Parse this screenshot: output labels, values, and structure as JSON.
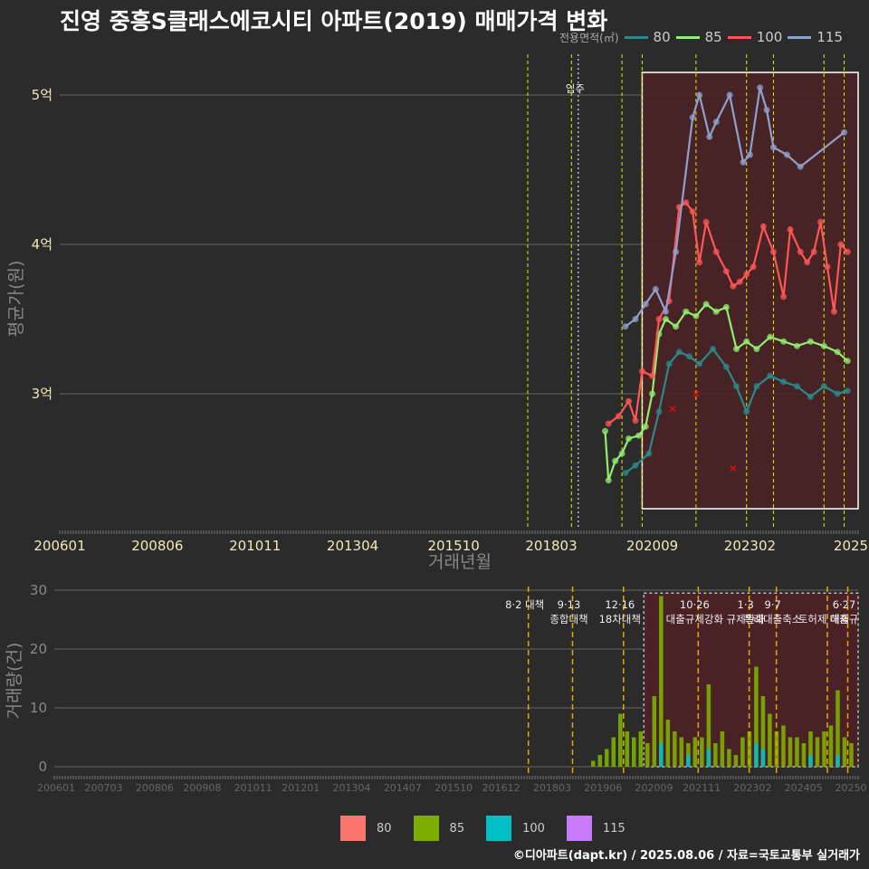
{
  "title": "진영 중흥S클래스에코시티 아파트(2019) 매매가격 변화",
  "legend_title": "전용면적(㎡)",
  "credit": "©디아파트(dapt.kr) / 2025.08.06 / 자료=국토교통부 실거래가",
  "colors": {
    "s80": "#f8766d",
    "s85": "#7cae00",
    "s100": "#00bfc4",
    "s115": "#c77cff",
    "line80": "#2a8a8a",
    "line85": "#90ee70",
    "line100": "#ff5555",
    "line115": "#8fa0cc",
    "vline": "#e6e600",
    "vline_bottom": "#e6a800",
    "highlight": "#4a2226",
    "box": "#ffffff"
  },
  "chart_data": [
    {
      "type": "line",
      "title": "진영 중흥S클래스에코시티 아파트(2019) 매매가격 변화",
      "xlabel": "거래년월",
      "ylabel": "평균가(원)",
      "x_ticks": [
        "200601",
        "200806",
        "201011",
        "201304",
        "201510",
        "201803",
        "202009",
        "202302",
        "2025"
      ],
      "y_ticks": [
        {
          "v": 3.0,
          "label": "3억"
        },
        {
          "v": 4.0,
          "label": "4억"
        },
        {
          "v": 5.0,
          "label": "5억"
        }
      ],
      "xlim": [
        "200512",
        "202508"
      ],
      "ylim": [
        2.1,
        5.3
      ],
      "legend": [
        "80",
        "85",
        "100",
        "115"
      ],
      "annotations": [
        {
          "x": "2018-11",
          "text": "입주"
        }
      ],
      "vlines": [
        "2017-08",
        "2018-09",
        "2019-12",
        "2020-06",
        "2021-10",
        "2023-01",
        "2023-09",
        "2024-12",
        "2025-06"
      ],
      "highlight_range": [
        "2020-06",
        "2025-08"
      ],
      "series": [
        {
          "name": "80",
          "points": [
            [
              "2020-01",
              2.47
            ],
            [
              "2020-04",
              2.52
            ],
            [
              "2020-08",
              2.6
            ],
            [
              "2020-11",
              2.88
            ],
            [
              "2021-02",
              3.2
            ],
            [
              "2021-05",
              3.28
            ],
            [
              "2021-08",
              3.25
            ],
            [
              "2021-11",
              3.2
            ],
            [
              "2022-03",
              3.3
            ],
            [
              "2022-07",
              3.18
            ],
            [
              "2022-10",
              3.05
            ],
            [
              "2023-01",
              2.88
            ],
            [
              "2023-04",
              3.05
            ],
            [
              "2023-08",
              3.12
            ],
            [
              "2023-12",
              3.08
            ],
            [
              "2024-04",
              3.05
            ],
            [
              "2024-08",
              2.98
            ],
            [
              "2024-12",
              3.05
            ],
            [
              "2025-04",
              3.0
            ],
            [
              "2025-07",
              3.02
            ]
          ]
        },
        {
          "name": "85",
          "points": [
            [
              "2019-07",
              2.75
            ],
            [
              "2019-08",
              2.42
            ],
            [
              "2019-10",
              2.55
            ],
            [
              "2019-12",
              2.6
            ],
            [
              "2020-02",
              2.7
            ],
            [
              "2020-05",
              2.72
            ],
            [
              "2020-07",
              2.78
            ],
            [
              "2020-09",
              3.0
            ],
            [
              "2020-11",
              3.4
            ],
            [
              "2021-01",
              3.5
            ],
            [
              "2021-04",
              3.45
            ],
            [
              "2021-07",
              3.55
            ],
            [
              "2021-10",
              3.52
            ],
            [
              "2022-01",
              3.6
            ],
            [
              "2022-04",
              3.55
            ],
            [
              "2022-07",
              3.58
            ],
            [
              "2022-10",
              3.3
            ],
            [
              "2023-01",
              3.35
            ],
            [
              "2023-04",
              3.3
            ],
            [
              "2023-08",
              3.38
            ],
            [
              "2023-12",
              3.35
            ],
            [
              "2024-04",
              3.32
            ],
            [
              "2024-08",
              3.35
            ],
            [
              "2024-12",
              3.32
            ],
            [
              "2025-04",
              3.28
            ],
            [
              "2025-07",
              3.22
            ]
          ]
        },
        {
          "name": "100",
          "points": [
            [
              "2019-08",
              2.8
            ],
            [
              "2019-11",
              2.85
            ],
            [
              "2020-02",
              2.95
            ],
            [
              "2020-04",
              2.82
            ],
            [
              "2020-06",
              3.15
            ],
            [
              "2020-09",
              3.12
            ],
            [
              "2020-11",
              3.5
            ],
            [
              "2021-02",
              3.62
            ],
            [
              "2021-05",
              4.25
            ],
            [
              "2021-07",
              4.28
            ],
            [
              "2021-09",
              4.22
            ],
            [
              "2021-11",
              3.88
            ],
            [
              "2022-01",
              4.15
            ],
            [
              "2022-04",
              3.95
            ],
            [
              "2022-07",
              3.82
            ],
            [
              "2022-09",
              3.72
            ],
            [
              "2022-11",
              3.75
            ],
            [
              "2023-01",
              3.8
            ],
            [
              "2023-03",
              3.85
            ],
            [
              "2023-06",
              4.12
            ],
            [
              "2023-09",
              3.95
            ],
            [
              "2023-12",
              3.65
            ],
            [
              "2024-02",
              4.1
            ],
            [
              "2024-05",
              3.95
            ],
            [
              "2024-07",
              3.88
            ],
            [
              "2024-09",
              3.95
            ],
            [
              "2024-11",
              4.15
            ],
            [
              "2025-01",
              3.85
            ],
            [
              "2025-03",
              3.55
            ],
            [
              "2025-05",
              4.0
            ],
            [
              "2025-07",
              3.95
            ]
          ]
        },
        {
          "name": "115",
          "points": [
            [
              "2020-01",
              3.45
            ],
            [
              "2020-04",
              3.5
            ],
            [
              "2020-07",
              3.6
            ],
            [
              "2020-10",
              3.7
            ],
            [
              "2021-01",
              3.55
            ],
            [
              "2021-04",
              3.95
            ],
            [
              "2021-09",
              4.85
            ],
            [
              "2021-11",
              5.0
            ],
            [
              "2022-02",
              4.72
            ],
            [
              "2022-04",
              4.82
            ],
            [
              "2022-08",
              5.0
            ],
            [
              "2022-12",
              4.55
            ],
            [
              "2023-02",
              4.6
            ],
            [
              "2023-05",
              5.05
            ],
            [
              "2023-07",
              4.9
            ],
            [
              "2023-09",
              4.65
            ],
            [
              "2024-01",
              4.6
            ],
            [
              "2024-05",
              4.52
            ],
            [
              "2025-06",
              4.75
            ]
          ]
        }
      ],
      "outliers_x": [
        [
          "2021-03",
          2.9
        ],
        [
          "2021-10",
          3.0
        ],
        [
          "2022-09",
          2.5
        ]
      ]
    },
    {
      "type": "bar",
      "xlabel": "",
      "ylabel": "거래량(건)",
      "x_ticks": [
        "200601",
        "200703",
        "200806",
        "200908",
        "201011",
        "201201",
        "201304",
        "201407",
        "201510",
        "201612",
        "201803",
        "201906",
        "202009",
        "202111",
        "202302",
        "202405",
        "20250"
      ],
      "y_ticks": [
        0,
        10,
        20,
        30
      ],
      "ylim": [
        0,
        30
      ],
      "legend": [
        "80",
        "85",
        "100",
        "115"
      ],
      "vline_annotations": [
        {
          "x": "2017-08",
          "lines": [
            "8·2 대책"
          ]
        },
        {
          "x": "2018-09",
          "lines": [
            "9·13",
            "종합대책"
          ]
        },
        {
          "x": "2019-12",
          "lines": [
            "12·16",
            "18차대책"
          ]
        },
        {
          "x": "2021-10",
          "lines": [
            "10·26",
            "대출규제강화"
          ]
        },
        {
          "x": "2023-01",
          "lines": [
            "1·3",
            "규제완화"
          ]
        },
        {
          "x": "2023-09",
          "lines": [
            "9·7",
            "특례대출축소"
          ]
        },
        {
          "x": "2024-12",
          "lines": [
            "",
            "토허제 해제"
          ]
        },
        {
          "x": "2025-06",
          "lines": [
            "6·27",
            "대출규"
          ]
        }
      ],
      "highlight_range": [
        "2020-06",
        "2025-08"
      ],
      "series": [
        {
          "name": "85",
          "values": [
            [
              "2019-03",
              1
            ],
            [
              "2019-05",
              2
            ],
            [
              "2019-07",
              3
            ],
            [
              "2019-09",
              5
            ],
            [
              "2019-11",
              9
            ],
            [
              "2020-01",
              6
            ],
            [
              "2020-03",
              5
            ],
            [
              "2020-05",
              6
            ],
            [
              "2020-07",
              4
            ],
            [
              "2020-09",
              12
            ],
            [
              "2020-11",
              29
            ],
            [
              "2021-01",
              8
            ],
            [
              "2021-03",
              6
            ],
            [
              "2021-05",
              5
            ],
            [
              "2021-07",
              4
            ],
            [
              "2021-09",
              5
            ],
            [
              "2021-11",
              5
            ],
            [
              "2022-01",
              14
            ],
            [
              "2022-03",
              4
            ],
            [
              "2022-05",
              6
            ],
            [
              "2022-07",
              3
            ],
            [
              "2022-09",
              2
            ],
            [
              "2022-11",
              5
            ],
            [
              "2023-01",
              6
            ],
            [
              "2023-03",
              17
            ],
            [
              "2023-05",
              12
            ],
            [
              "2023-07",
              9
            ],
            [
              "2023-09",
              6
            ],
            [
              "2023-11",
              7
            ],
            [
              "2024-01",
              5
            ],
            [
              "2024-03",
              5
            ],
            [
              "2024-05",
              4
            ],
            [
              "2024-07",
              6
            ],
            [
              "2024-09",
              5
            ],
            [
              "2024-11",
              6
            ],
            [
              "2025-01",
              7
            ],
            [
              "2025-03",
              13
            ],
            [
              "2025-05",
              5
            ],
            [
              "2025-07",
              4
            ]
          ]
        },
        {
          "name": "100",
          "values": [
            [
              "2020-11",
              4
            ],
            [
              "2021-07",
              2
            ],
            [
              "2022-01",
              3
            ],
            [
              "2023-03",
              4
            ],
            [
              "2023-05",
              3
            ],
            [
              "2024-07",
              2
            ],
            [
              "2025-03",
              2
            ]
          ]
        }
      ]
    }
  ]
}
